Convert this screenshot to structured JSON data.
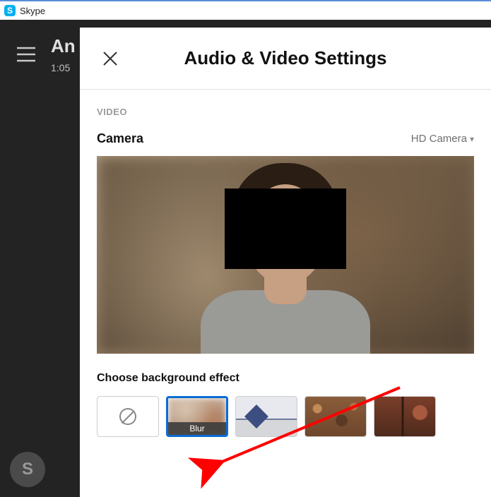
{
  "titlebar": {
    "app_name": "Skype"
  },
  "background": {
    "contact_name": "An",
    "time": "1:05",
    "logo_letter": "S"
  },
  "panel": {
    "title": "Audio & Video Settings",
    "section_label": "VIDEO",
    "camera_label": "Camera",
    "camera_selected": "HD Camera",
    "effect_section_label": "Choose background effect",
    "effects": {
      "none": {
        "name": "none"
      },
      "blur": {
        "name": "blur",
        "caption": "Blur"
      },
      "room1": {
        "name": "room-bg-1"
      },
      "room2": {
        "name": "room-bg-2"
      },
      "room3": {
        "name": "room-bg-3"
      }
    }
  }
}
